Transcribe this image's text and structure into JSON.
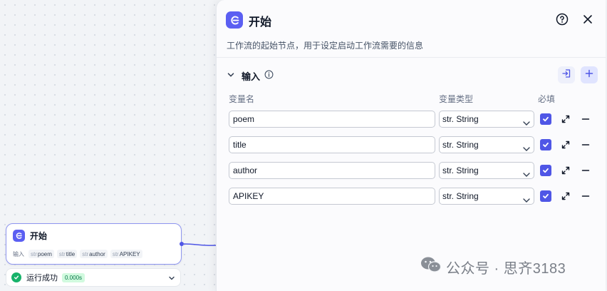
{
  "node": {
    "title": "开始",
    "inputs_label": "输入",
    "type_prefix": "str",
    "variables": [
      "poem",
      "title",
      "author",
      "APIKEY"
    ]
  },
  "run": {
    "status": "运行成功",
    "duration": "0.000s"
  },
  "panel": {
    "title": "开始",
    "description": "工作流的起始节点，用于设定启动工作流需要的信息",
    "section_title": "输入",
    "columns": {
      "name": "变量名",
      "type": "变量类型",
      "required": "必填"
    },
    "rows": [
      {
        "name": "poem",
        "type": "str. String",
        "required": true
      },
      {
        "name": "title",
        "type": "str. String",
        "required": true
      },
      {
        "name": "author",
        "type": "str. String",
        "required": true
      },
      {
        "name": "APIKEY",
        "type": "str. String",
        "required": true
      }
    ]
  },
  "watermark": "公众号 · 思齐3183",
  "icons": {
    "node": "start-node-icon",
    "status": "success-check-icon",
    "help": "help-circle-icon",
    "close": "close-icon",
    "section": "chevron-down-icon",
    "info": "info-icon",
    "import": "import-icon",
    "add": "plus-icon",
    "expand": "expand-icon",
    "remove": "minus-icon",
    "watermark": "wechat-icon"
  },
  "colors": {
    "accent": "#5b5ff2",
    "success": "#17b26a",
    "node_border": "#8f96f0"
  }
}
